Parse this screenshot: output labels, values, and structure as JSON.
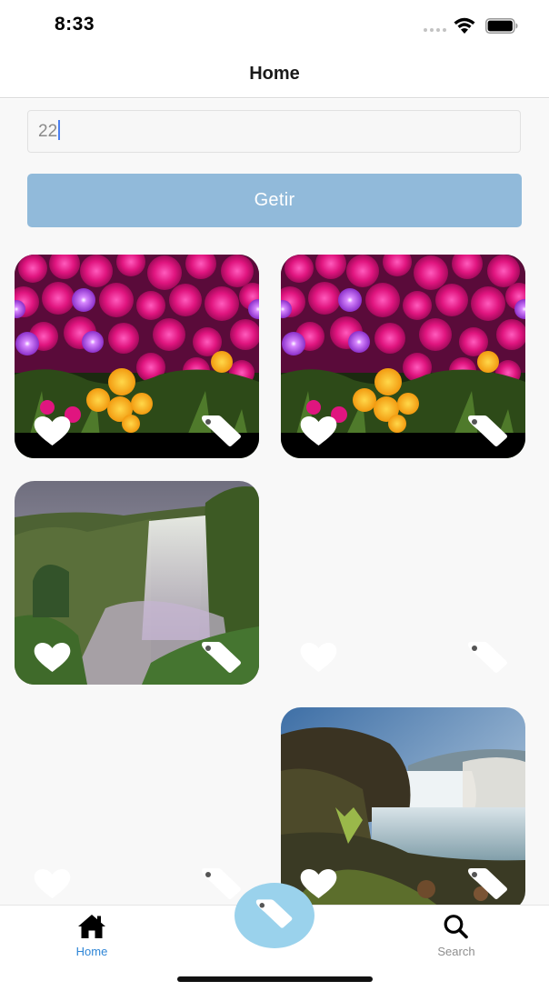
{
  "status_bar": {
    "time": "8:33"
  },
  "header": {
    "title": "Home"
  },
  "search": {
    "value": "22"
  },
  "button": {
    "label": "Getir"
  },
  "cards": [
    {
      "photo": "flowers-photo",
      "icons": [
        "heart-icon",
        "tag-icon"
      ]
    },
    {
      "photo": "flowers-photo",
      "icons": [
        "heart-icon",
        "tag-icon"
      ]
    },
    {
      "photo": "waterfall-photo",
      "icons": [
        "heart-icon",
        "tag-icon"
      ]
    },
    {
      "photo": "empty",
      "icons": [
        "heart-icon",
        "tag-icon"
      ]
    },
    {
      "photo": "empty",
      "icons": [
        "heart-icon",
        "tag-icon"
      ]
    },
    {
      "photo": "river-waterfall-photo",
      "icons": [
        "heart-icon",
        "tag-icon"
      ]
    }
  ],
  "tab_bar": {
    "home_label": "Home",
    "search_label": "Search",
    "active": "Home",
    "fab_icon": "tag-icon"
  },
  "colors": {
    "button_bg": "#91bada",
    "fab_bg": "#9ad2ec",
    "active_tab": "#2f86d6",
    "inactive_tab": "#8e8e8e"
  }
}
